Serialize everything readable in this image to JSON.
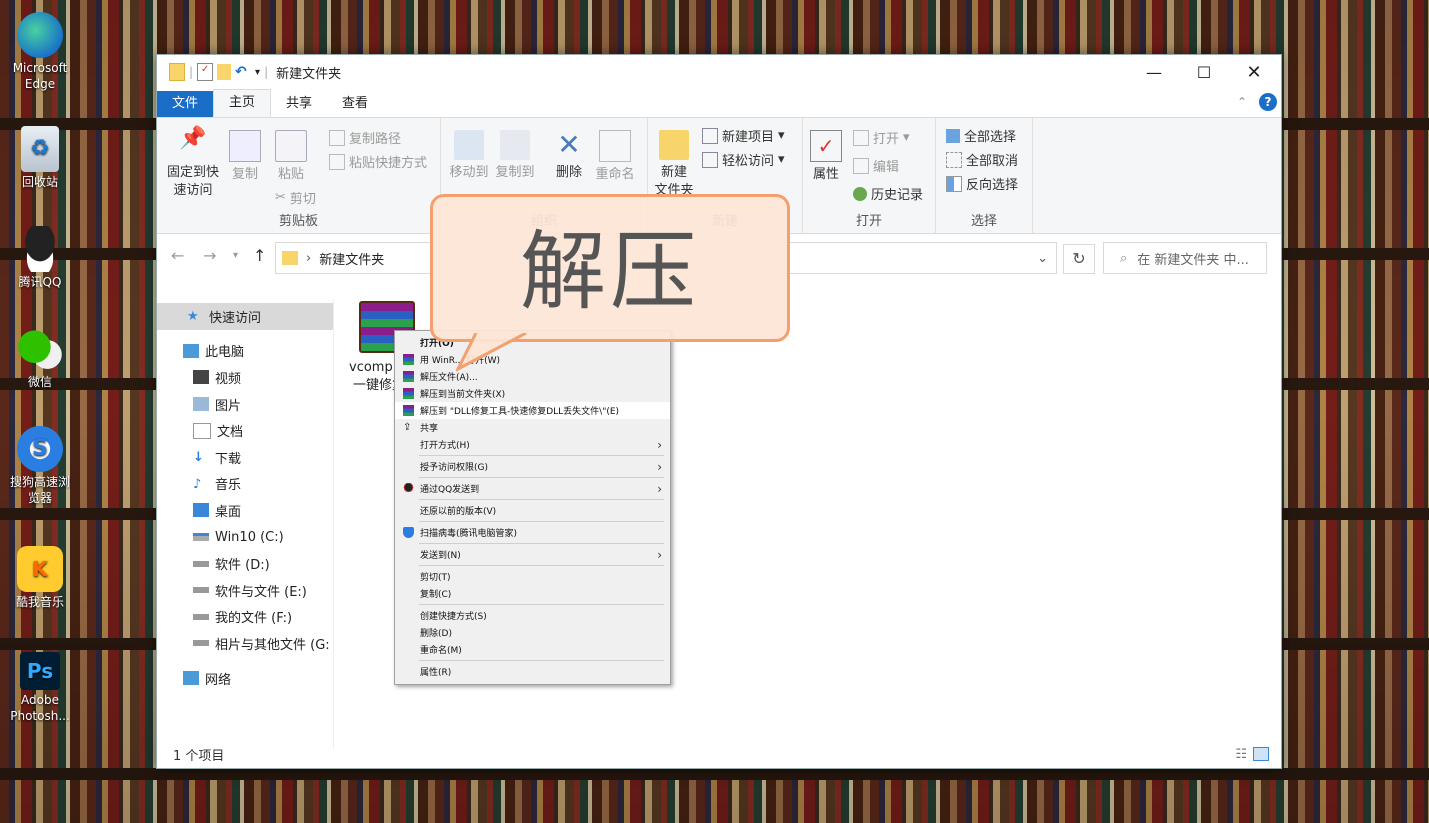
{
  "desktop": {
    "icons": [
      {
        "label": "Microsoft\nEdge",
        "line1": "Microsoft",
        "line2": "Edge"
      },
      {
        "label": "回收站"
      },
      {
        "label": "腾讯QQ"
      },
      {
        "label": "微信"
      },
      {
        "label": "搜狗高速浏览器",
        "line1": "搜狗高速浏",
        "line2": "览器"
      },
      {
        "label": "酷我音乐"
      },
      {
        "label": "Adobe Photosh...",
        "line1": "Adobe",
        "line2": "Photosh..."
      }
    ]
  },
  "window": {
    "title": "新建文件夹",
    "tabs": [
      "文件",
      "主页",
      "共享",
      "查看"
    ],
    "ribbon": {
      "clipboard": {
        "pin_line1": "固定到快",
        "pin_line2": "速访问",
        "copy": "复制",
        "paste": "粘贴",
        "copy_path": "复制路径",
        "paste_shortcut": "粘贴快捷方式",
        "cut": "剪切",
        "group": "剪贴板"
      },
      "organize": {
        "move_to": "移动到",
        "copy_to": "复制到",
        "delete": "删除",
        "rename": "重命名",
        "group": "组织"
      },
      "new": {
        "new_folder_line1": "新建",
        "new_folder_line2": "文件夹",
        "new_item": "新建项目",
        "easy_access": "轻松访问",
        "group": "新建"
      },
      "open": {
        "properties": "属性",
        "open": "打开",
        "edit": "编辑",
        "history": "历史记录",
        "group": "打开"
      },
      "select": {
        "select_all": "全部选择",
        "select_none": "全部取消",
        "invert": "反向选择",
        "group": "选择"
      }
    },
    "address": {
      "path": "新建文件夹",
      "search_placeholder": "在 新建文件夹 中..."
    },
    "nav": [
      {
        "label": "快速访问"
      },
      {
        "label": "此电脑"
      },
      {
        "label": "视频"
      },
      {
        "label": "图片"
      },
      {
        "label": "文档"
      },
      {
        "label": "下载"
      },
      {
        "label": "音乐"
      },
      {
        "label": "桌面"
      },
      {
        "label": "Win10 (C:)"
      },
      {
        "label": "软件 (D:)"
      },
      {
        "label": "软件与文件 (E:)"
      },
      {
        "label": "我的文件 (F:)"
      },
      {
        "label": "相片与其他文件 (G:"
      },
      {
        "label": "网络"
      }
    ],
    "file": {
      "name_line1": "vcomp",
      "name_line2": "一键修复"
    },
    "status": "1 个项目"
  },
  "context_menu": {
    "items": [
      "打开(O)",
      "用 WinR... 打开(W)",
      "解压文件(A)...",
      "解压到当前文件夹(X)",
      "解压到 \"DLL修复工具-快速修复DLL丢失文件\\\"(E)",
      "共享",
      "打开方式(H)",
      "授予访问权限(G)",
      "通过QQ发送到",
      "还原以前的版本(V)",
      "扫描病毒(腾讯电脑管家)",
      "发送到(N)",
      "剪切(T)",
      "复制(C)",
      "创建快捷方式(S)",
      "删除(D)",
      "重命名(M)",
      "属性(R)"
    ]
  },
  "callout": {
    "text": "解压"
  },
  "colors": {
    "accent": "#1a6ec8",
    "callout_border": "#f3a06e",
    "callout_fill": "#fce5d6"
  }
}
